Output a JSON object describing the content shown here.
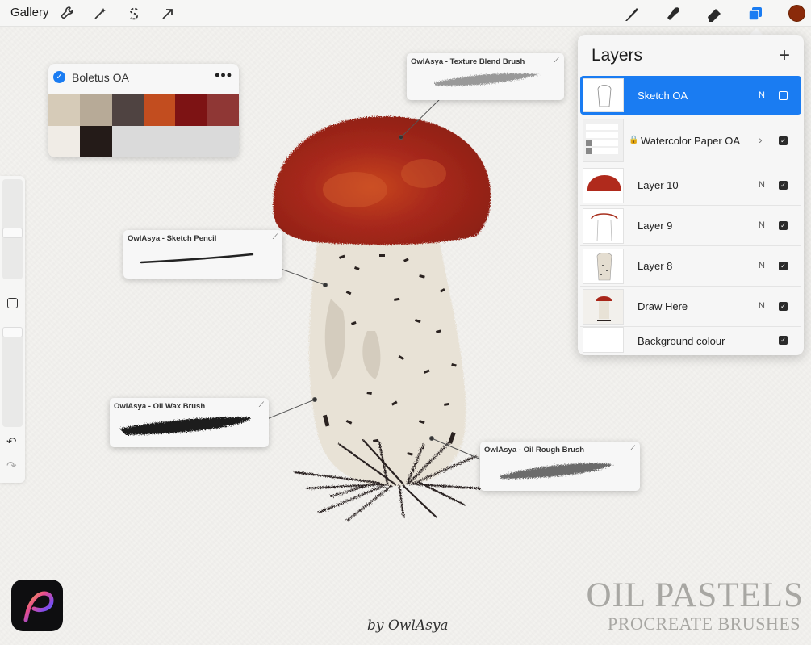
{
  "toolbar": {
    "gallery_label": "Gallery",
    "left_icons": [
      "wrench-icon",
      "magic-wand-icon",
      "selection-s-icon",
      "transform-arrow-icon"
    ],
    "right_icons": [
      "brush-icon",
      "smudge-icon",
      "eraser-icon",
      "layers-icon"
    ],
    "current_color": "#8a2a0a",
    "accent_color": "#1a7cf2"
  },
  "palette": {
    "name": "Boletus OA",
    "more_label": "•••",
    "row1": [
      "#d6cbb8",
      "#b7aa97",
      "#4f4341",
      "#c24d1f",
      "#7d1314",
      "#8f3735"
    ],
    "row2": [
      "#f0ece6",
      "#241b18",
      "#dadada",
      "#dadada",
      "#dadada",
      "#dadada"
    ]
  },
  "layers": {
    "title": "Layers",
    "add_label": "+",
    "items": [
      {
        "name": "Sketch OA",
        "mode": "N",
        "visible": false,
        "selected": true
      },
      {
        "name": "Watercolor Paper OA",
        "mode": "",
        "visible": true,
        "locked": true,
        "group": true
      },
      {
        "name": "Layer 10",
        "mode": "N",
        "visible": true
      },
      {
        "name": "Layer 9",
        "mode": "N",
        "visible": true
      },
      {
        "name": "Layer 8",
        "mode": "N",
        "visible": true
      },
      {
        "name": "Draw Here",
        "mode": "N",
        "visible": true
      },
      {
        "name": "Background colour",
        "mode": "",
        "visible": true
      }
    ]
  },
  "brushes": {
    "texture_blend": "OwlAsya - Texture Blend Brush",
    "sketch_pencil": "OwlAsya - Sketch Pencil",
    "oil_wax": "OwlAsya - Oil Wax Brush",
    "oil_rough": "OwlAsya - Oil Rough Brush"
  },
  "footer": {
    "byline": "by OwlAsya",
    "title": "OIL PASTELS",
    "subtitle": "PROCREATE BRUSHES"
  }
}
